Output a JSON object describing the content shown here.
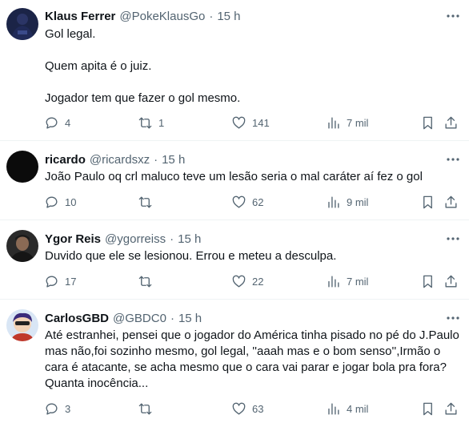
{
  "tweets": [
    {
      "name": "Klaus Ferrer",
      "handle": "@PokeKlausGo",
      "time": "15 h",
      "lines": [
        "Gol legal.",
        "",
        "Quem apita é o juiz.",
        "",
        "Jogador tem que fazer o gol mesmo."
      ],
      "replies": "4",
      "retweets": "1",
      "likes": "141",
      "views": "7 mil"
    },
    {
      "name": "ricardo",
      "handle": "@ricardsxz",
      "time": "15 h",
      "lines": [
        "João Paulo oq crl maluco teve um lesão seria o mal caráter aí fez o gol"
      ],
      "replies": "10",
      "retweets": "",
      "likes": "62",
      "views": "9 mil"
    },
    {
      "name": "Ygor Reis",
      "handle": "@ygorreiss",
      "time": "15 h",
      "lines": [
        "Duvido que ele se lesionou. Errou e meteu a desculpa."
      ],
      "replies": "17",
      "retweets": "",
      "likes": "22",
      "views": "7 mil"
    },
    {
      "name": "CarlosGBD",
      "handle": "@GBDC0",
      "time": "15 h",
      "lines": [
        "Até estranhei, pensei que o jogador do América tinha pisado no pé do J.Paulo",
        "mas não,foi sozinho mesmo, gol legal, ''aaah mas e o bom senso'',Irmão o",
        "cara é atacante, se acha mesmo que o cara vai parar e jogar bola pra fora?",
        "Quanta inocência..."
      ],
      "replies": "3",
      "retweets": "",
      "likes": "63",
      "views": "4 mil"
    }
  ],
  "dot": "·"
}
